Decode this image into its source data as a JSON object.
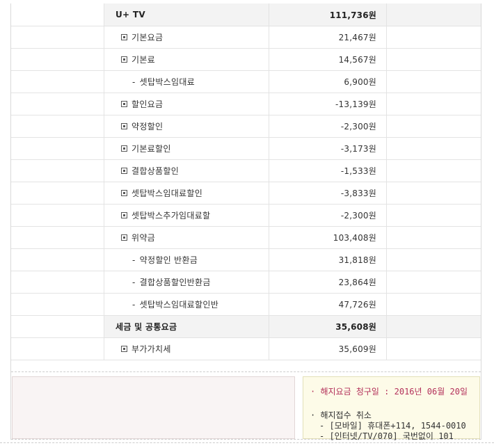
{
  "table": {
    "rows": [
      {
        "type": "section",
        "label": "U+ TV",
        "amount": "111,736원"
      },
      {
        "type": "item",
        "label": "기본요금",
        "amount": "21,467원"
      },
      {
        "type": "item",
        "label": "기본료",
        "amount": "14,567원"
      },
      {
        "type": "sub",
        "label": "셋탑박스임대료",
        "amount": "6,900원"
      },
      {
        "type": "item",
        "label": "할인요금",
        "amount": "-13,139원"
      },
      {
        "type": "item",
        "label": "약정할인",
        "amount": "-2,300원"
      },
      {
        "type": "item",
        "label": "기본료할인",
        "amount": "-3,173원"
      },
      {
        "type": "item",
        "label": "결합상품할인",
        "amount": "-1,533원"
      },
      {
        "type": "item",
        "label": "셋탑박스임대료할인",
        "amount": "-3,833원"
      },
      {
        "type": "item",
        "label": "셋탑박스추가임대료할",
        "amount": "-2,300원"
      },
      {
        "type": "item",
        "label": "위약금",
        "amount": "103,408원"
      },
      {
        "type": "sub",
        "label": "약정할인 반환금",
        "amount": "31,818원"
      },
      {
        "type": "sub",
        "label": "결합상품할인반환금",
        "amount": "23,864원"
      },
      {
        "type": "sub",
        "label": "셋탑박스임대료할인반",
        "amount": "47,726원"
      },
      {
        "type": "section",
        "label": "세금 및 공통요금",
        "amount": "35,608원"
      },
      {
        "type": "item",
        "label": "부가가치세",
        "amount": "35,609원"
      }
    ]
  },
  "notice": {
    "billing_label": "· 해지요금 청구일 : 2016년 06월 20일",
    "cancel_label": "· 해지접수 취소",
    "cancel_mobile": "- [모바일] 휴대폰+114, 1544-0010",
    "cancel_internet": "- [인터넷/TV/070] 국번없이 101"
  },
  "colors": {
    "section_bg": "#f3f3f3",
    "notice_bg": "#fdfbe8",
    "notice_accent": "#b3305a",
    "memo_bg": "#f9f4f4"
  },
  "icons": {
    "item_marker": "square-bullet-icon",
    "sub_marker": "dash"
  }
}
